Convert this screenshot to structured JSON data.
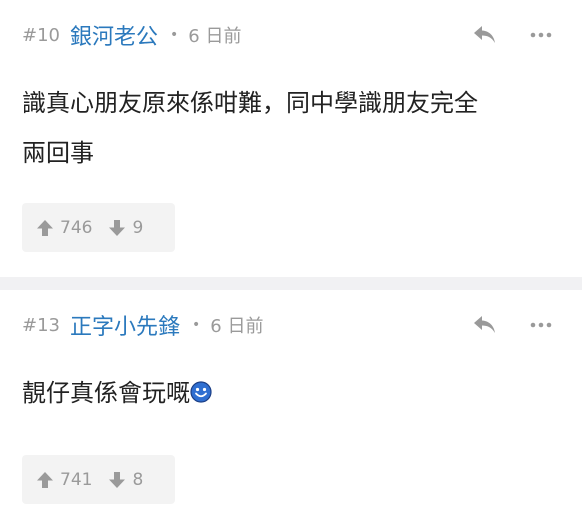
{
  "posts": [
    {
      "floor": "#10",
      "username": "銀河老公",
      "separator": "•",
      "time": "6 日前",
      "content_lines": [
        "識真心朋友原來係咁難，同中學識朋友完全",
        "兩回事"
      ],
      "upvotes": "746",
      "downvotes": "9"
    },
    {
      "floor": "#13",
      "username": "正字小先鋒",
      "separator": "•",
      "time": "6 日前",
      "content_lines": [
        "靚仔真係會玩嘅"
      ],
      "emoji": "smiley-emoji",
      "upvotes": "741",
      "downvotes": "8"
    }
  ],
  "icons": {
    "reply": "reply-icon",
    "more": "more-icon",
    "upvote": "arrow-up-icon",
    "downvote": "arrow-down-icon"
  },
  "colors": {
    "username": "#2b79bd",
    "meta": "#9a9a9a",
    "vote_bg": "#f3f3f3",
    "divider": "#f1f1f3",
    "emoji": "#2f6fd1"
  }
}
